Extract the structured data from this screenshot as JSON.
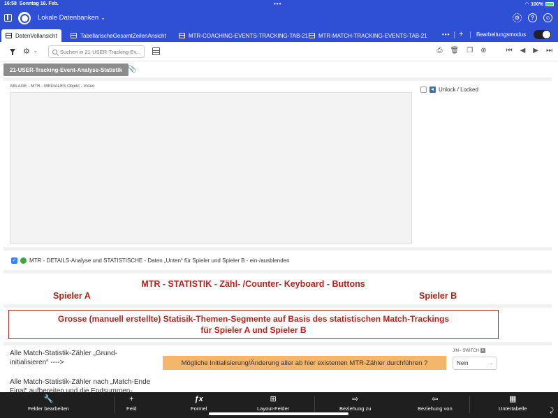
{
  "status": {
    "time": "16:58",
    "date": "Sonntag 16. Feb.",
    "battery": "100%"
  },
  "app": {
    "db_name": "Lokale Datenbanken"
  },
  "tabs": [
    {
      "label": "DatenVollansicht",
      "active": true
    },
    {
      "label": "TabellarischeGesamtZeilenAnsicht"
    },
    {
      "label": "MTR-COACHING-EVENTS-TRACKING-TAB-21"
    },
    {
      "label": "MTR-MATCH-TRACKING-EVENTS-TAB-21"
    }
  ],
  "tabbar": {
    "more": "•••",
    "plus": "+",
    "mode_label": "Bearbeitungsmodus"
  },
  "toolbar": {
    "search_placeholder": "Suchen in 21-USER-Tracking-Ev..."
  },
  "section": {
    "title": "21-USER-Tracking-Event-Analyse-Statistik"
  },
  "media": {
    "label": "ABLAGE - MTR - MEDIALES Objekt - Video"
  },
  "lock": {
    "label": "Unlock / Locked"
  },
  "details": {
    "label": "MTR - DETAILS-Analyse und STATISTISCHE - Daten „Unten“ für Spieler und Spieler B - ein-/ausblenden"
  },
  "statistik": {
    "title": "MTR - STATISTIK - Zähl- /Counter- Keyboard - Buttons",
    "spieler_a": "Spieler A",
    "spieler_b": "Spieler B",
    "segment_line1": "Grosse (manuell erstellte) Statisik-Themen-Segmente auf Basis des statistischen Match-Trackings",
    "segment_line2": "für Spieler A und Spieler B"
  },
  "init": {
    "label": "Alle Match-Statistik-Zähler „Grund-initialisieren“ ---->",
    "button": "Mögliche Initialisierung/Änderung aller ab hier existenten MTR-Zähler durchführen ?",
    "switch_label": "J/N - SWITCH",
    "switch_value": "Nein"
  },
  "final": {
    "label": "Alle Match-Statistik-Zähler nach „Match-Ende Final“ aufbereiten und die Endsummen-"
  },
  "bottombar": [
    {
      "label": "Felder bearbeiten",
      "icon": "wrench-icon",
      "glyph": "🔧"
    },
    {
      "label": "Feld",
      "icon": "plus-icon",
      "glyph": "+"
    },
    {
      "label": "Formel",
      "icon": "formula-icon",
      "glyph": "ƒx"
    },
    {
      "label": "Layout-Felder",
      "icon": "layout-icon",
      "glyph": "⊞"
    },
    {
      "label": "Beziehung zu",
      "icon": "arrow-right-icon",
      "glyph": "⇨"
    },
    {
      "label": "Beziehung von",
      "icon": "arrow-left-icon",
      "glyph": "⇦"
    },
    {
      "label": "Untertabelle",
      "icon": "subtable-icon",
      "glyph": "▦"
    }
  ]
}
